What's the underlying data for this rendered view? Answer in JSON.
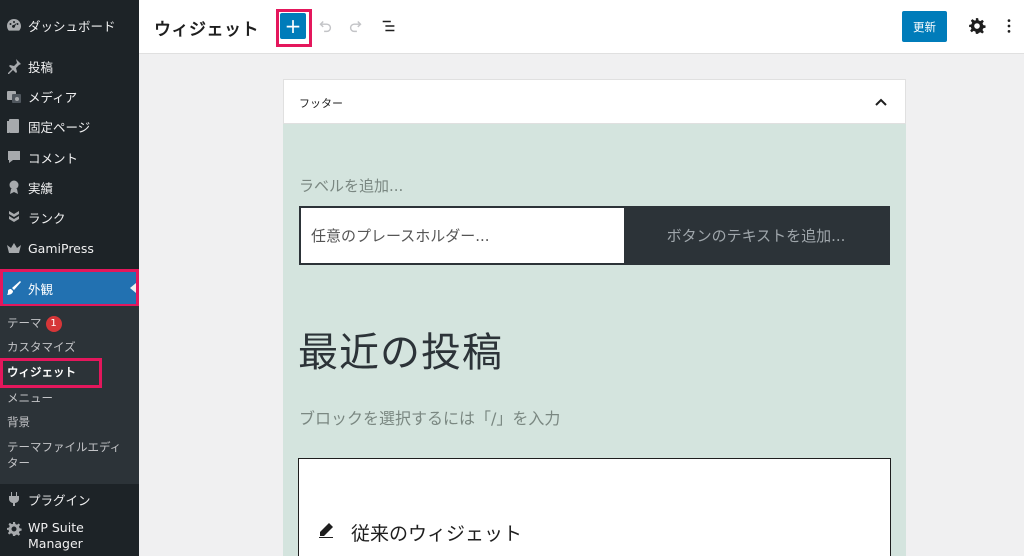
{
  "sidebar": {
    "items": [
      {
        "label": "ダッシュボード",
        "icon": "dashboard-icon"
      },
      {
        "label": "投稿",
        "icon": "pin-icon"
      },
      {
        "label": "メディア",
        "icon": "media-icon"
      },
      {
        "label": "固定ページ",
        "icon": "page-icon"
      },
      {
        "label": "コメント",
        "icon": "comment-icon"
      },
      {
        "label": "実績",
        "icon": "award-icon"
      },
      {
        "label": "ランク",
        "icon": "rank-icon"
      },
      {
        "label": "GamiPress",
        "icon": "crown-icon"
      },
      {
        "label": "外観",
        "icon": "brush-icon"
      },
      {
        "label": "プラグイン",
        "icon": "plugin-icon"
      },
      {
        "label": "WP Suite Manager",
        "icon": "gear-icon"
      }
    ],
    "submenu": [
      {
        "label": "テーマ",
        "badge": "1"
      },
      {
        "label": "カスタマイズ"
      },
      {
        "label": "ウィジェット"
      },
      {
        "label": "メニュー"
      },
      {
        "label": "背景"
      },
      {
        "label": "テーマファイルエディター"
      }
    ]
  },
  "header": {
    "title": "ウィジェット",
    "add_label": "+",
    "update_label": "更新"
  },
  "card": {
    "title": "フッター",
    "label_placeholder": "ラベルを追加...",
    "search_placeholder": "任意のプレースホルダー...",
    "button_placeholder": "ボタンのテキストを追加...",
    "recent_title": "最近の投稿",
    "block_hint": "ブロックを選択するには「/」を入力",
    "legacy_label": "従来のウィジェット"
  },
  "colors": {
    "accent": "#007cba",
    "highlight": "#e4175c",
    "sidebar_bg": "#1d2327",
    "active_menu": "#2271b1",
    "area_bg": "#d4e4de"
  }
}
